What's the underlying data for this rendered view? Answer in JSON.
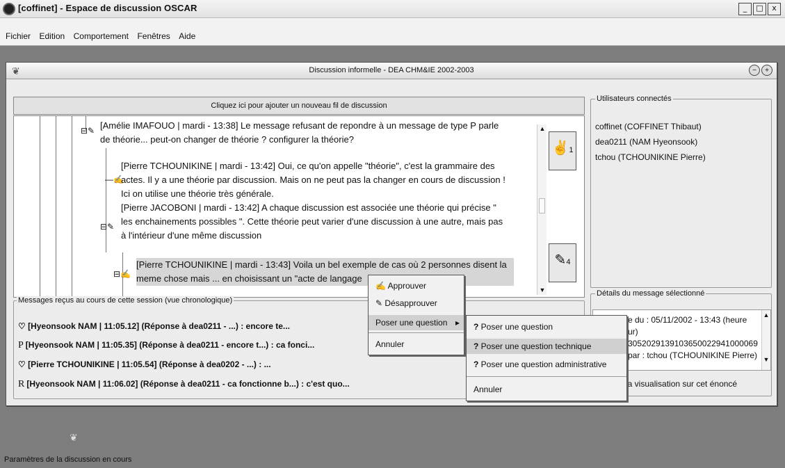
{
  "window": {
    "title": "[coffinet] - Espace de discussion OSCAR",
    "minimize": "_",
    "maximize": "□",
    "close": "x"
  },
  "menu": [
    "Fichier",
    "Edition",
    "Comportement",
    "Fenêtres",
    "Aide"
  ],
  "discussion": {
    "title": "Discussion informelle - DEA CHM&IE 2002-2003",
    "add_thread": "Cliquez ici pour ajouter un nouveau fil de discussion",
    "messages": [
      {
        "lines": [
          "[Amélie IMAFOUO | mardi - 13:38] Le message refusant de repondre à un message de type P parle",
          "de théorie... peut-on changer de théorie ? configurer la théorie?"
        ]
      },
      {
        "lines": [
          "[Pierre TCHOUNIKINE | mardi - 13:42] Oui, ce qu'on appelle \"théorie\", c'est la grammaire des",
          "actes. Il y a une théorie par discussion. Mais on ne peut pas la changer en cours de discussion !",
          "Ici on utilise une théorie très générale."
        ]
      },
      {
        "lines": [
          "[Pierre JACOBONI | mardi - 13:42] A chaque discussion est associée une théorie qui précise \"",
          "les enchainements possibles \". Cette théorie peut varier d'une discussion à une autre, mais pas",
          "à l'intérieur d'une même discussion"
        ]
      },
      {
        "lines": [
          "[Pierre TCHOUNIKINE | mardi - 13:43] Voila un bel exemple de cas où 2 personnes disent la",
          "meme chose mais ... en choisissant un \"acte de langage"
        ]
      }
    ],
    "approve_count": "1",
    "disapprove_count": "4"
  },
  "users": {
    "legend": "Utilisateurs connectés",
    "list": [
      "coffinet (COFFINET Thibaut)",
      "dea0211 (NAM Hyeonsook)",
      "tchou (TCHOUNIKINE Pierre)"
    ]
  },
  "details": {
    "legend": "Détails du message sélectionné",
    "lines": [
      "e du : 05/11/2002 - 13:43 (heure",
      "ur)",
      "3052029139103650022941000069",
      "par : tchou (TCHOUNIKINE Pierre)"
    ],
    "footer": "la visualisation sur cet énoncé"
  },
  "received": {
    "legend": "Messages reçus au cours de cette session (vue chronologique)",
    "items": [
      {
        "type": "",
        "text": "[Hyeonsook NAM | 11:05.12]  (Réponse à dea0211 - ...) : encore te..."
      },
      {
        "type": "P",
        "text": "[Hyeonsook NAM | 11:05.35]  (Réponse à dea0211 - encore t...) : ca fonci..."
      },
      {
        "type": "",
        "text": "[Pierre TCHOUNIKINE | 11:05.54]  (Réponse à dea0202 - ...) : ..."
      },
      {
        "type": "R",
        "text": "[Hyeonsook NAM | 11:06.02]  (Réponse à dea0211 - ca fonctionne b...) : c'est quo..."
      }
    ]
  },
  "context_menu": {
    "items": [
      "Approuver",
      "Désapprouver",
      "Poser une question",
      "Annuler"
    ],
    "submenu": [
      "Poser une question",
      "Poser une question technique",
      "Poser une question administrative",
      "Annuler"
    ]
  },
  "bottom_label": "Paramètres de la discussion en cours"
}
